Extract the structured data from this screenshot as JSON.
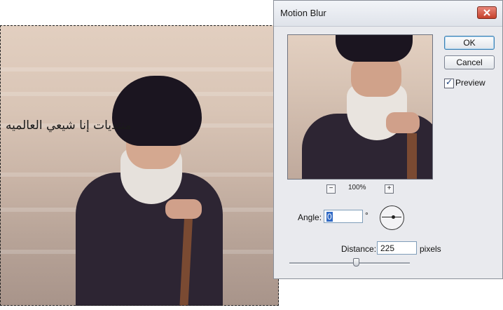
{
  "canvas": {
    "overlay_text": "منتديات إنا شيعي العالميه"
  },
  "dialog": {
    "title": "Motion Blur",
    "ok_label": "OK",
    "cancel_label": "Cancel",
    "preview_label": "Preview",
    "preview_checked": true,
    "zoom_minus": "−",
    "zoom_plus": "+",
    "zoom_level": "100%",
    "angle_label": "Angle:",
    "angle_value": "0",
    "degree_symbol": "°",
    "distance_label": "Distance:",
    "distance_value": "225",
    "distance_unit": "pixels",
    "distance_slider_fraction": 0.53
  },
  "colors": {
    "ok_highlight": "#3c7fb1",
    "close_button": "#c5412c",
    "selection_highlight": "#316ac5"
  },
  "icons": {
    "close": "close-x-icon",
    "preview_check": "checkmark-icon"
  }
}
